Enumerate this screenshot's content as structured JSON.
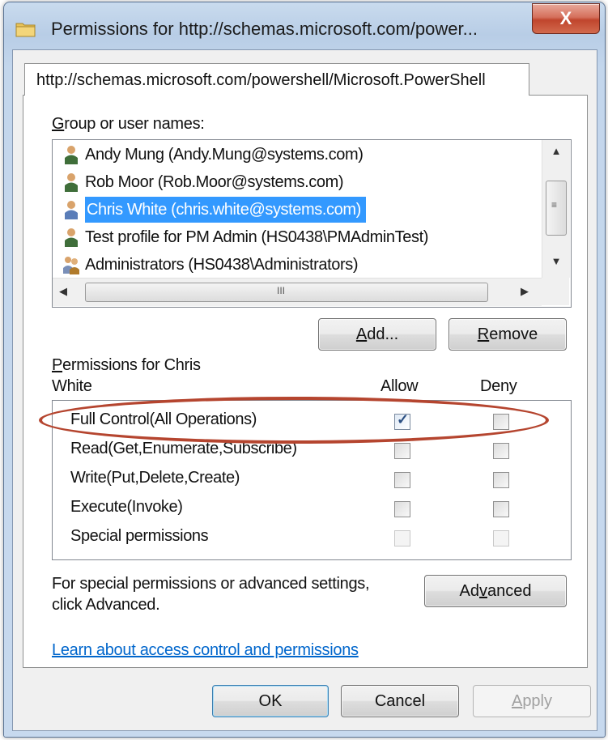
{
  "window": {
    "title": "Permissions for http://schemas.microsoft.com/power...",
    "close_label": "X",
    "title_icon": "folder-icon"
  },
  "tab": {
    "label": "http://schemas.microsoft.com/powershell/Microsoft.PowerShell"
  },
  "group_section": {
    "label_first": "G",
    "label_rest": "roup or user names:",
    "users": [
      {
        "name": "Andy Mung (Andy.Mung@systems.com)",
        "icon": "user-icon",
        "selected": false
      },
      {
        "name": "Rob Moor (Rob.Moor@systems.com)",
        "icon": "user-icon",
        "selected": false
      },
      {
        "name": "Chris White (chris.white@systems.com)",
        "icon": "user-icon",
        "selected": true
      },
      {
        "name": "Test profile for PM Admin (HS0438\\PMAdminTest)",
        "icon": "user-icon",
        "selected": false
      },
      {
        "name": "Administrators (HS0438\\Administrators)",
        "icon": "group-users-icon",
        "selected": false
      }
    ],
    "scroll_grip_h": "III",
    "scroll_grip_v": "≡"
  },
  "buttons": {
    "add_a": "A",
    "add_u": "d",
    "add_rest": "d...",
    "remove_first": "R",
    "remove_rest": "emove",
    "advanced_pre": "Ad",
    "advanced_u": "v",
    "advanced_rest": "anced",
    "ok": "OK",
    "cancel": "Cancel",
    "apply_first": "A",
    "apply_rest": "pply"
  },
  "permissions": {
    "label_first": "P",
    "label_line1_rest": "ermissions for Chris",
    "label_line2": "White",
    "allow_header": "Allow",
    "deny_header": "Deny",
    "rows": [
      {
        "name": "Full Control(All Operations)",
        "allow": true,
        "deny": false
      },
      {
        "name": "Read(Get,Enumerate,Subscribe)",
        "allow": false,
        "deny": false
      },
      {
        "name": "Write(Put,Delete,Create)",
        "allow": false,
        "deny": false
      },
      {
        "name": "Execute(Invoke)",
        "allow": false,
        "deny": false
      },
      {
        "name": "Special permissions",
        "allow": false,
        "deny": false
      }
    ]
  },
  "advanced_text": {
    "line1": "For special permissions or advanced settings,",
    "line2": "click Advanced."
  },
  "link": {
    "text": "Learn about access control and permissions"
  },
  "colors": {
    "selection": "#3399ff",
    "highlight_ellipse": "#b5452f",
    "link": "#0066cc"
  }
}
